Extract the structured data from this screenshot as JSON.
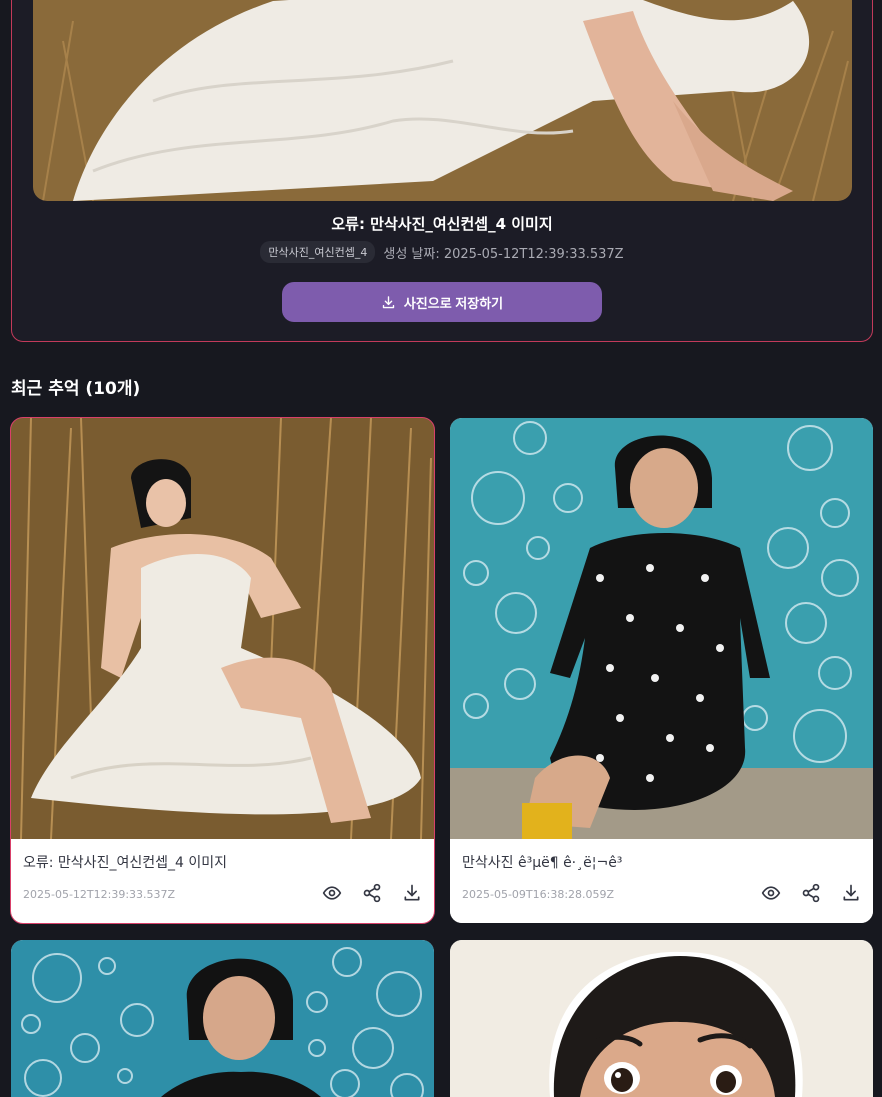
{
  "detail": {
    "title": "오류: 만삭사진_여신컨셉_4 이미지",
    "tag": "만삭사진_여신컨셉_4",
    "date_text": "생성 날짜: 2025-05-12T12:39:33.537Z",
    "save_label": "사진으로 저장하기"
  },
  "section": {
    "title": "최근 추억 (10개)"
  },
  "cards": [
    {
      "title": "오류: 만삭사진_여신컨셉_4 이미지",
      "date": "2025-05-12T12:39:33.537Z",
      "selected": true
    },
    {
      "title": "만삭사진 ê³µë¶ ê·¸ë¦¬ê³",
      "date": "2025-05-09T16:38:28.059Z",
      "selected": false
    },
    {
      "title": "",
      "date": ""
    },
    {
      "title": "",
      "date": ""
    }
  ],
  "colors": {
    "background": "#17181f",
    "accent_button": "#7e5cad",
    "selected_border": "#d9406a"
  },
  "icons": [
    "download-icon",
    "eye-icon",
    "share-icon"
  ]
}
